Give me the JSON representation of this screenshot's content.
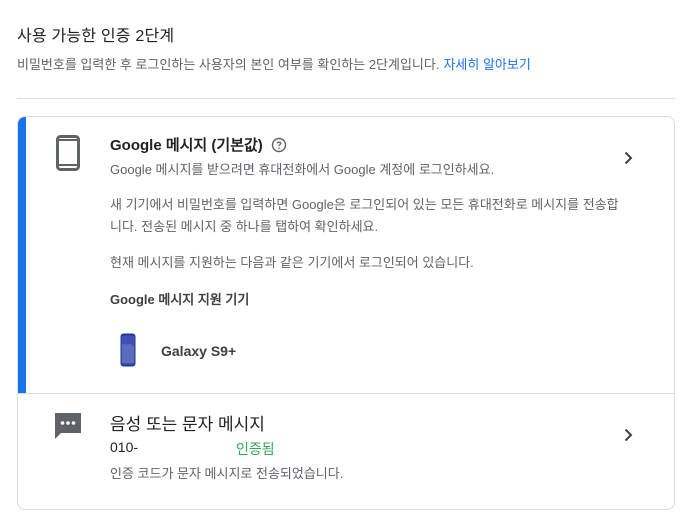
{
  "header": {
    "title": "사용 가능한 인증 2단계",
    "description": "비밀번호를 입력한 후 로그인하는 사용자의 본인 여부를 확인하는 2단계입니다.",
    "learn_more": "자세히 알아보기"
  },
  "google_prompt": {
    "title": "Google 메시지 (기본값)",
    "line1": "Google 메시지를 받으려면 휴대전화에서 Google 계정에 로그인하세요.",
    "line2": "새 기기에서 비밀번호를 입력하면 Google은 로그인되어 있는 모든 휴대전화로 메시지를 전송합니다. 전송된 메시지 중 하나를 탭하여 확인하세요.",
    "line3": "현재 메시지를 지원하는 다음과 같은 기기에서 로그인되어 있습니다.",
    "supported_title": "Google 메시지 지원 기기",
    "device_name": "Galaxy S9+"
  },
  "voice_text": {
    "title": "음성 또는 문자 메시지",
    "phone": "010-",
    "status": "인증됨",
    "note": "인증 코드가 문자 메시지로 전송되었습니다."
  },
  "colors": {
    "accent": "#1a73e8",
    "verified": "#34a853",
    "icon_gray": "#5f6368"
  }
}
